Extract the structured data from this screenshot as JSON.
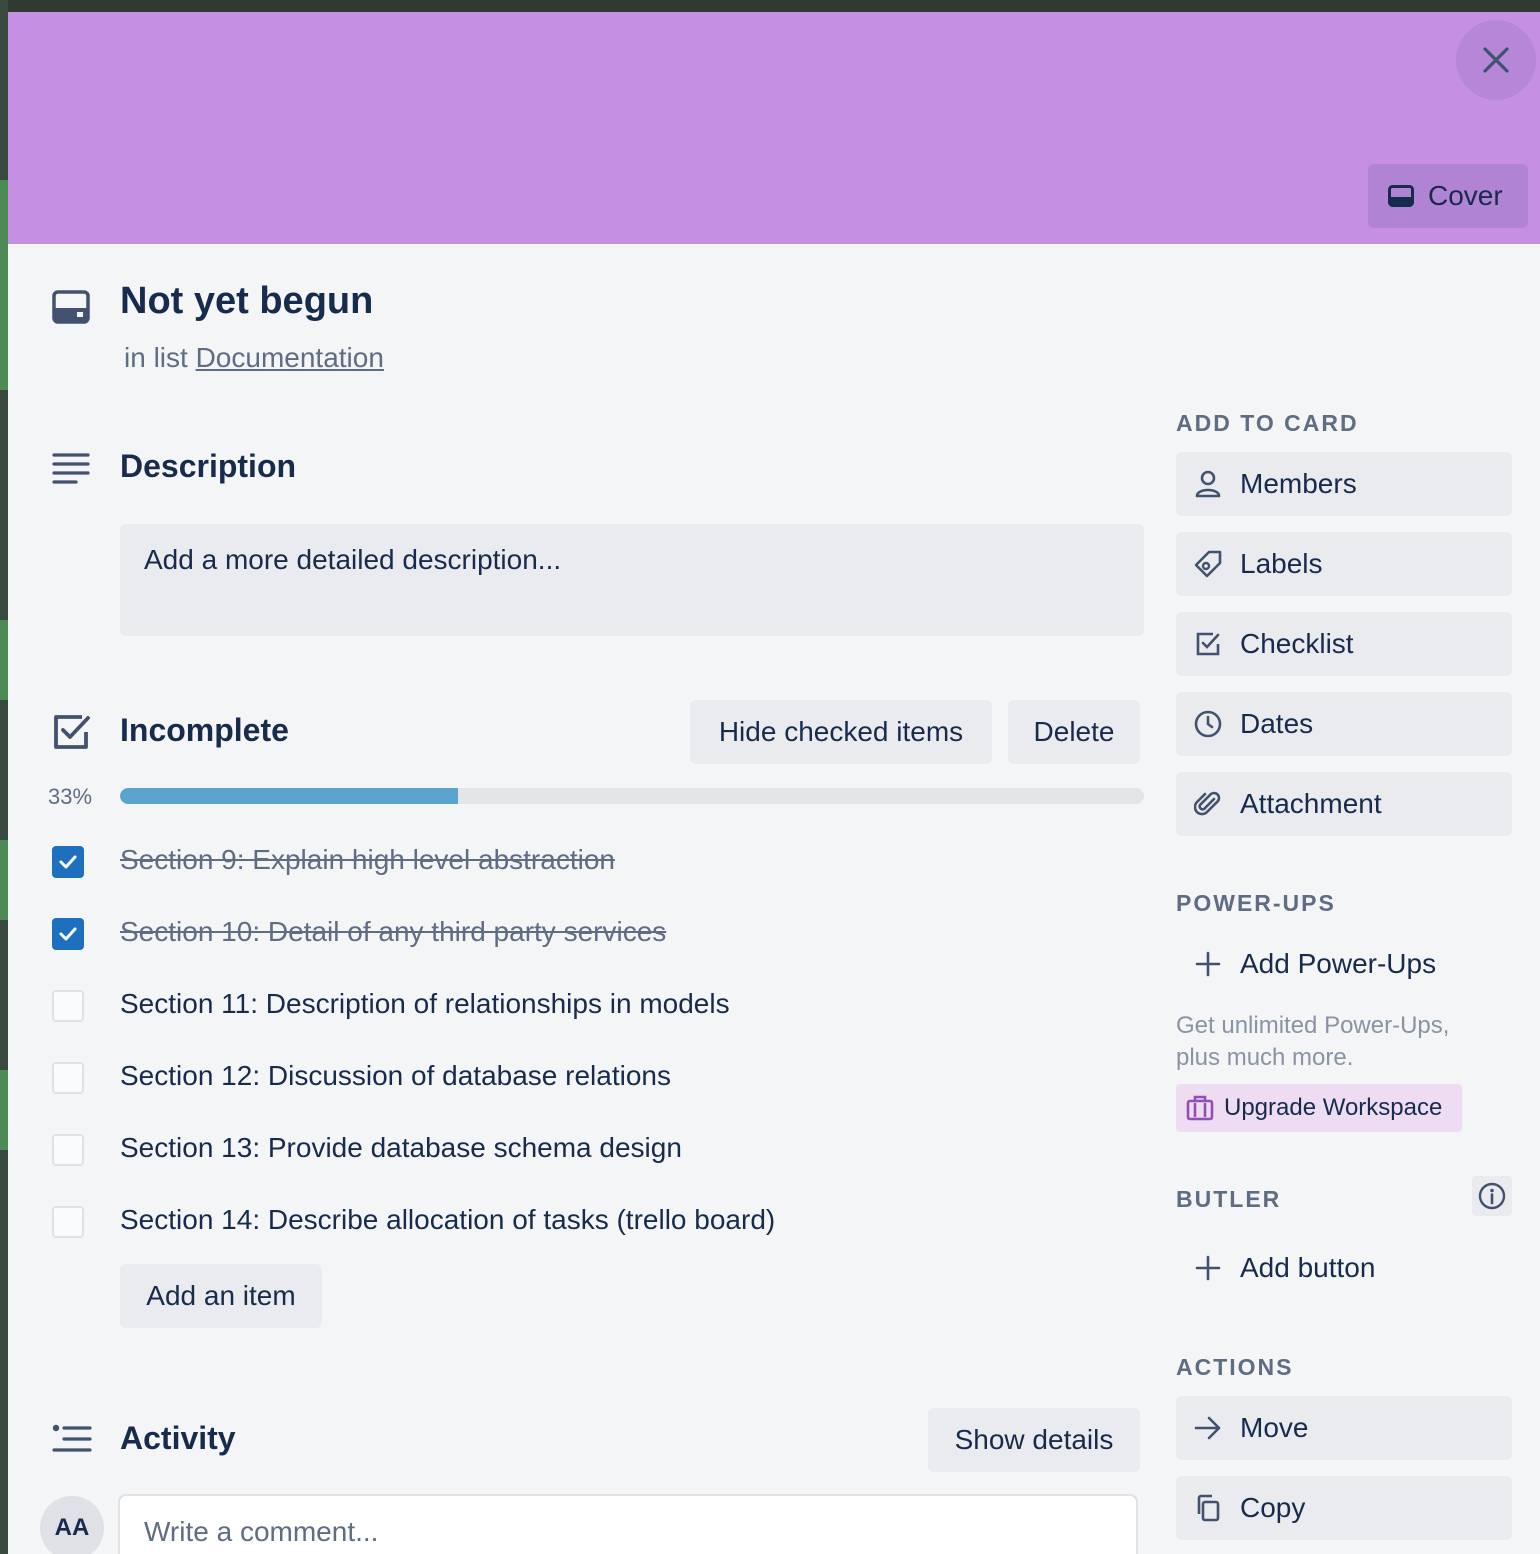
{
  "colors": {
    "cover": "#c590e4",
    "accent": "#1f6fbf",
    "progress": "#5ba4cf",
    "upgrade_bg": "#eedcf3"
  },
  "cover": {
    "button_label": "Cover"
  },
  "card": {
    "title": "Not yet begun",
    "in_list_prefix": "in list",
    "list_name": "Documentation"
  },
  "description": {
    "title": "Description",
    "placeholder": "Add a more detailed description..."
  },
  "checklist": {
    "title": "Incomplete",
    "hide_checked_label": "Hide checked items",
    "delete_label": "Delete",
    "progress_text": "33%",
    "progress_fraction": 0.33,
    "items": [
      {
        "text": "Section 9: Explain high level abstraction",
        "checked": true
      },
      {
        "text": "Section 10: Detail of any third party services",
        "checked": true
      },
      {
        "text": "Section 11: Description of relationships in models",
        "checked": false
      },
      {
        "text": "Section 12: Discussion of database relations",
        "checked": false
      },
      {
        "text": "Section 13: Provide database schema design",
        "checked": false
      },
      {
        "text": "Section 14: Describe allocation of tasks (trello board)",
        "checked": false
      }
    ],
    "add_item_label": "Add an item"
  },
  "activity": {
    "title": "Activity",
    "show_details_label": "Show details",
    "avatar_initials": "AA",
    "comment_placeholder": "Write a comment..."
  },
  "sidebar": {
    "add_to_card": {
      "heading": "ADD TO CARD",
      "buttons": [
        {
          "label": "Members",
          "icon": "person-icon"
        },
        {
          "label": "Labels",
          "icon": "tag-icon"
        },
        {
          "label": "Checklist",
          "icon": "checkbox-icon"
        },
        {
          "label": "Dates",
          "icon": "clock-icon"
        },
        {
          "label": "Attachment",
          "icon": "paperclip-icon"
        }
      ]
    },
    "power_ups": {
      "heading": "POWER-UPS",
      "add_label": "Add Power-Ups",
      "promo_text": "Get unlimited Power-Ups, plus much more.",
      "upgrade_label": "Upgrade Workspace"
    },
    "butler": {
      "heading": "BUTLER",
      "add_button_label": "Add button"
    },
    "actions": {
      "heading": "ACTIONS",
      "buttons": [
        {
          "label": "Move",
          "icon": "arrow-right-icon"
        },
        {
          "label": "Copy",
          "icon": "copy-icon"
        }
      ]
    }
  }
}
